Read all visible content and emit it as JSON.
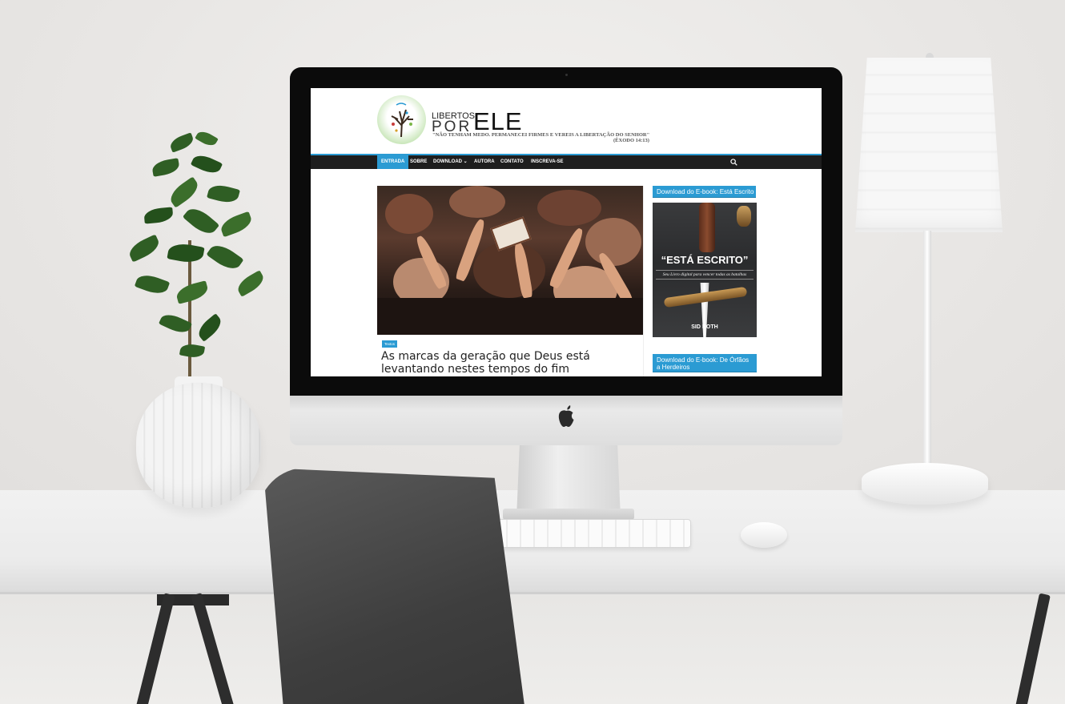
{
  "site": {
    "logo": {
      "libertos": "LIBERTOS",
      "por": "POR",
      "ele": "ELE"
    },
    "tagline": "\"NÃO TENHAM MEDO. PERMANECEI FIRMES E VEREIS A LIBERTAÇÃO DO SENHOR\"",
    "tagline_ref": "(ÊXODO 14:13)",
    "nav": {
      "items": [
        {
          "label": "ENTRADA",
          "active": true
        },
        {
          "label": "SOBRE"
        },
        {
          "label": "DOWNLOAD ⌄"
        },
        {
          "label": "AUTORA"
        },
        {
          "label": "CONTATO"
        },
        {
          "label": "INSCREVA-SE"
        }
      ],
      "search_icon": "search-icon"
    },
    "post": {
      "category": "Textos",
      "title": "As marcas da geração que Deus está levantando nestes tempos do fim"
    },
    "sidebar": {
      "widget1_title": "Download do E-book: Está Escrito",
      "ebook": {
        "title": "“ESTÁ ESCRITO”",
        "subtitle": "Seu Livro digital para vencer todas as batalhas",
        "author": "SID ROTH"
      },
      "widget2_title": "Download do E-book: De Órfãos a Herdeiros"
    },
    "colors": {
      "accent": "#2b9bd3",
      "nav_bg": "#1e1e1e"
    }
  }
}
